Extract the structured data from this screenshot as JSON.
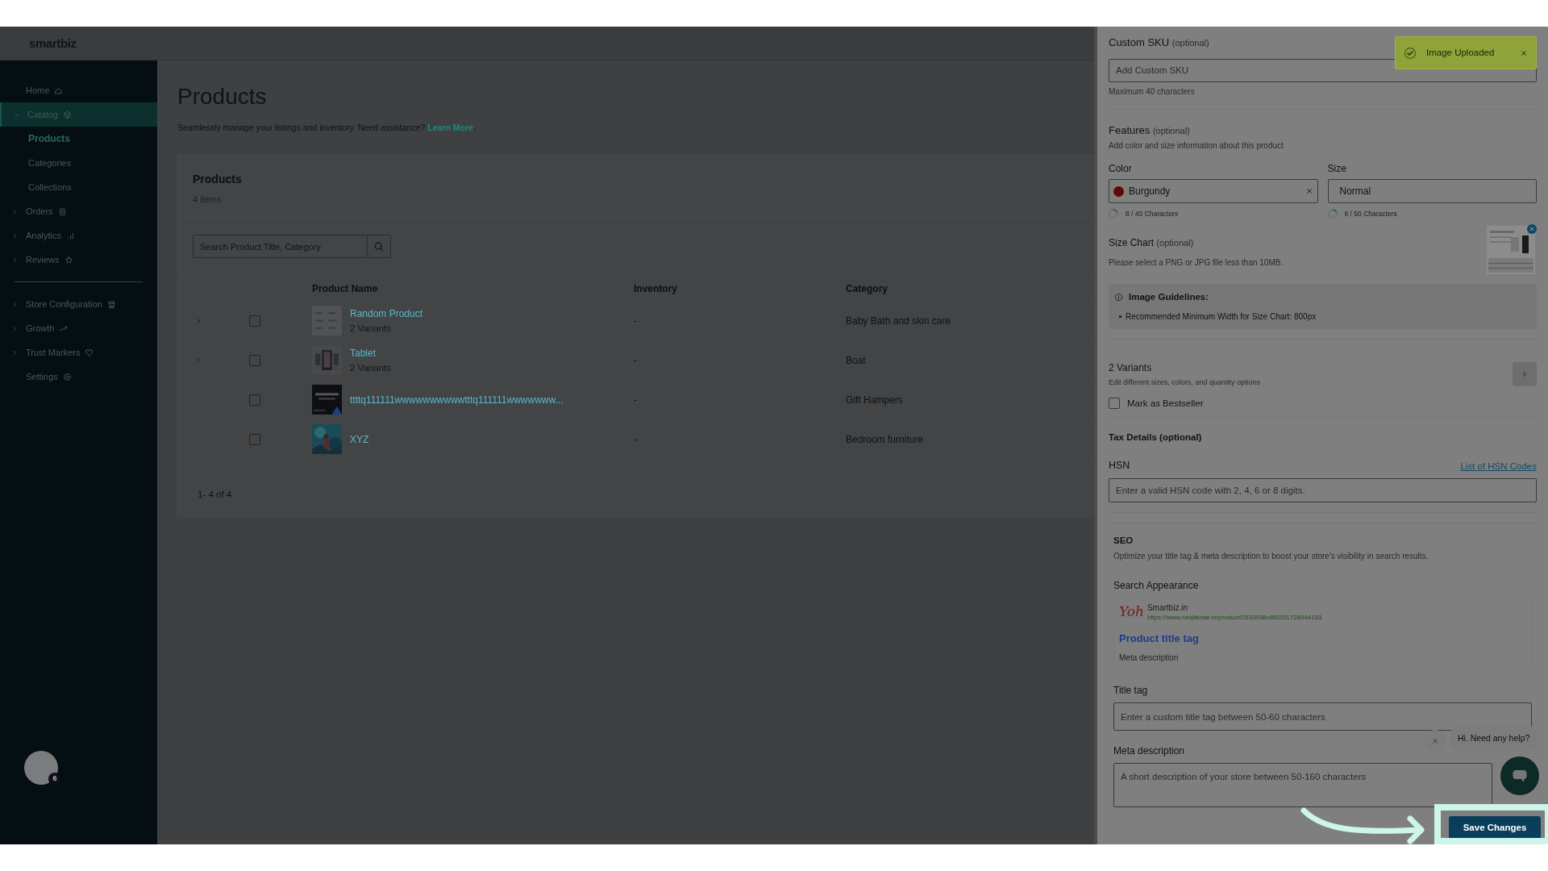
{
  "header": {
    "logo": "smartbiz"
  },
  "sidebar": {
    "sections": [
      {
        "items": [
          {
            "label": "Home",
            "expandable": false,
            "expanded": false,
            "selected": false
          },
          {
            "label": "Catalog",
            "expandable": true,
            "expanded": true,
            "selected": true,
            "children": [
              {
                "label": "Products",
                "selected": true
              },
              {
                "label": "Categories",
                "selected": false
              },
              {
                "label": "Collections",
                "selected": false
              }
            ]
          },
          {
            "label": "Orders",
            "expandable": true,
            "expanded": false,
            "selected": false
          },
          {
            "label": "Analytics",
            "expandable": true,
            "expanded": false,
            "selected": false
          },
          {
            "label": "Reviews",
            "expandable": true,
            "expanded": false,
            "selected": false
          }
        ]
      },
      {
        "items": [
          {
            "label": "Store Configuration",
            "expandable": true,
            "expanded": false,
            "selected": false
          },
          {
            "label": "Growth",
            "expandable": true,
            "expanded": false,
            "selected": false
          },
          {
            "label": "Trust Markers",
            "expandable": true,
            "expanded": false,
            "selected": false
          },
          {
            "label": "Settings",
            "expandable": false,
            "expanded": false,
            "selected": false
          }
        ]
      }
    ],
    "avatar_badge": "6"
  },
  "page": {
    "title": "Products",
    "description": "Seamlessly manage your listings and inventory. Need assistance?",
    "link": "Learn More",
    "description_end": "."
  },
  "card": {
    "title": "Products",
    "count": "4 items",
    "search": {
      "placeholder": "Search Product Title, Category"
    },
    "columns": [
      "Product Name",
      "Inventory",
      "Category"
    ],
    "rows": [
      {
        "expandable": true,
        "checked": false,
        "name": "Random Product",
        "variants": "2 Variants",
        "inventory": "-",
        "category": "Baby Bath and skin care"
      },
      {
        "expandable": true,
        "checked": false,
        "name": "Tablet",
        "variants": "2 Variants",
        "inventory": "-",
        "category": "Boat"
      },
      {
        "expandable": false,
        "checked": false,
        "name": "ttttq111111wwwwwwwwwwtttq111111wwwwwww...",
        "inventory": "-",
        "category": "Gift Hampers"
      },
      {
        "expandable": false,
        "checked": false,
        "name": "XYZ",
        "inventory": "-",
        "category": "Bedroom furniture"
      }
    ],
    "pagination": "1- 4 of 4"
  },
  "panel": {
    "sku": {
      "label": "Custom SKU",
      "optional": "(optional)",
      "placeholder": "Add Custom SKU",
      "hint": "Maximum 40 characters"
    },
    "features": {
      "title": "Features",
      "optional": "(optional)",
      "description": "Add color and size information about this product",
      "fields": [
        {
          "label": "Color",
          "value": "Burgundy",
          "color": "#5e0808",
          "clearable": true,
          "counter": "8 / 40 Characters"
        },
        {
          "label": "Size",
          "value": "Normal",
          "clearable": false,
          "counter": "6 / 50 Characters"
        }
      ]
    },
    "size_chart": {
      "label": "Size Chart",
      "optional": "(optional)",
      "hint": "Please select a PNG or JPG file less than 10MB."
    },
    "guidelines": {
      "title": "Image Guidelines:",
      "items": [
        "Recommended Minimum Width for Size Chart: 800px"
      ]
    },
    "variants": {
      "title": "2 Variants",
      "description": "Edit different sizes, colors, and quantity options"
    },
    "bestseller": {
      "label": "Mark as Bestseller",
      "checked": false
    },
    "tax": {
      "title": "Tax Details (optional)",
      "label": "HSN",
      "link": "List of HSN Codes",
      "placeholder": "Enter a valid HSN code with 2, 4, 6 or 8 digits."
    },
    "seo": {
      "title": "SEO",
      "description": "Optimize your title tag & meta description to boost your store's visibility in search results.",
      "appearance_label": "Search Appearance",
      "preview": {
        "favicon": "Yoh",
        "site": "Smartbiz.in",
        "url": "https://www.ranjitknair.in/product/2533938c8f0201726044183",
        "title": "Product title tag",
        "description": "Meta description"
      },
      "title_label": "Title tag",
      "title_placeholder": "Enter a custom title tag between 50-60 characters",
      "meta_label": "Meta description",
      "meta_placeholder": "A short description of your store between 50-160 characters"
    },
    "save": "Save Changes"
  },
  "toast": {
    "text": "Image Uploaded"
  },
  "chat": {
    "text": "Hi. Need any help?"
  }
}
